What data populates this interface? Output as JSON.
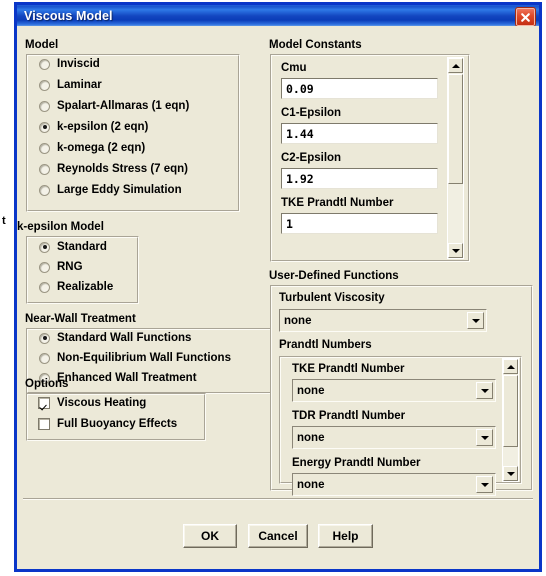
{
  "window": {
    "title": "Viscous Model",
    "close_icon": "close-icon",
    "accent_color": "#0a36c8",
    "face_color": "#ece9d8"
  },
  "background_peek_text": "t",
  "model_group": {
    "label": "Model",
    "items": [
      {
        "label": "Inviscid",
        "selected": false
      },
      {
        "label": "Laminar",
        "selected": false
      },
      {
        "label": "Spalart-Allmaras   (1 eqn)",
        "selected": false
      },
      {
        "label": "k-epsilon   (2 eqn)",
        "selected": true
      },
      {
        "label": "k-omega   (2 eqn)",
        "selected": false
      },
      {
        "label": "Reynolds Stress   (7 eqn)",
        "selected": false
      },
      {
        "label": "Large Eddy Simulation",
        "selected": false
      }
    ]
  },
  "kepsilon_group": {
    "label": "k-epsilon Model",
    "items": [
      {
        "label": "Standard",
        "selected": true
      },
      {
        "label": "RNG",
        "selected": false
      },
      {
        "label": "Realizable",
        "selected": false
      }
    ]
  },
  "nearwall_group": {
    "label": "Near-Wall Treatment",
    "items": [
      {
        "label": "Standard Wall Functions",
        "selected": true
      },
      {
        "label": "Non-Equilibrium Wall Functions",
        "selected": false
      },
      {
        "label": "Enhanced Wall Treatment",
        "selected": false
      }
    ]
  },
  "options_group": {
    "label": "Options",
    "items": [
      {
        "label": "Viscous Heating",
        "checked": true
      },
      {
        "label": "Full Buoyancy Effects",
        "checked": false
      }
    ]
  },
  "model_constants": {
    "label": "Model Constants",
    "fields": [
      {
        "label": "Cmu",
        "value": "0.09"
      },
      {
        "label": "C1-Epsilon",
        "value": "1.44"
      },
      {
        "label": "C2-Epsilon",
        "value": "1.92"
      },
      {
        "label": "TKE Prandtl Number",
        "value": "1"
      }
    ],
    "scrollbar": {
      "up_icon": "scroll-up-arrow-icon",
      "down_icon": "scroll-down-arrow-icon"
    }
  },
  "udf": {
    "label": "User-Defined Functions",
    "turbulent_viscosity": {
      "label": "Turbulent Viscosity",
      "value": "none",
      "arrow_icon": "chevron-down-icon"
    },
    "prandtl_numbers": {
      "label": "Prandtl Numbers",
      "fields": [
        {
          "label": "TKE Prandtl Number",
          "value": "none",
          "arrow_icon": "chevron-down-icon"
        },
        {
          "label": "TDR Prandtl Number",
          "value": "none",
          "arrow_icon": "chevron-down-icon"
        },
        {
          "label": "Energy Prandtl Number",
          "value": "none",
          "arrow_icon": "chevron-down-icon"
        }
      ],
      "scrollbar": {
        "up_icon": "scroll-up-arrow-icon",
        "down_icon": "scroll-down-arrow-icon"
      }
    }
  },
  "buttons": {
    "ok": "OK",
    "cancel": "Cancel",
    "help": "Help"
  }
}
